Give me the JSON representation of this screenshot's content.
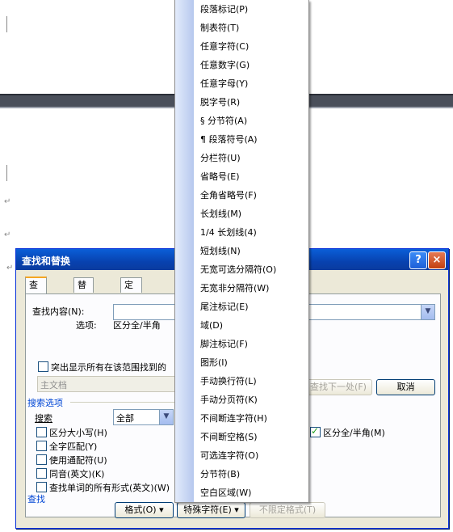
{
  "dialog": {
    "title": "查找和替换",
    "help": "?",
    "close": "×",
    "tabs": [
      "查找(D)",
      "替换(P)",
      "定位(G)"
    ],
    "find_label": "查找内容(N):",
    "options_label": "选项:",
    "options_value": "区分全/半角",
    "highlight_label": "突出显示所有在该范围找到的",
    "scope_value": "主文档",
    "find_next": "查找下一处(F)",
    "cancel": "取消",
    "search_options_head": "搜索选项",
    "search_label": "搜索",
    "search_value": "全部",
    "checkboxes": [
      {
        "label": "区分大小写(H)",
        "checked": false
      },
      {
        "label": "全字匹配(Y)",
        "checked": false
      },
      {
        "label": "使用通配符(U)",
        "checked": false
      },
      {
        "label": "同音(英文)(K)",
        "checked": false
      },
      {
        "label": "查找单词的所有形式(英文)(W)",
        "checked": false
      }
    ],
    "fullwidth_label": "区分全/半角(M)",
    "fullwidth_checked": true,
    "find_head": "查找",
    "format_btn": "格式(O) ▾",
    "special_btn": "特殊字符(E) ▾",
    "noformat_btn": "不限定格式(T)"
  },
  "menu": {
    "items": [
      "段落标记(P)",
      "制表符(T)",
      "任意字符(C)",
      "任意数字(G)",
      "任意字母(Y)",
      "脱字号(R)",
      "§ 分节符(A)",
      "¶ 段落符号(A)",
      "分栏符(U)",
      "省略号(E)",
      "全角省略号(F)",
      "长划线(M)",
      "1/4 长划线(4)",
      "短划线(N)",
      "无宽可选分隔符(O)",
      "无宽非分隔符(W)",
      "尾注标记(E)",
      "域(D)",
      "脚注标记(F)",
      "图形(I)",
      "手动换行符(L)",
      "手动分页符(K)",
      "不间断连字符(H)",
      "不间断空格(S)",
      "可选连字符(O)",
      "分节符(B)",
      "空白区域(W)"
    ]
  },
  "doc": {
    "para_mark": "↵"
  }
}
